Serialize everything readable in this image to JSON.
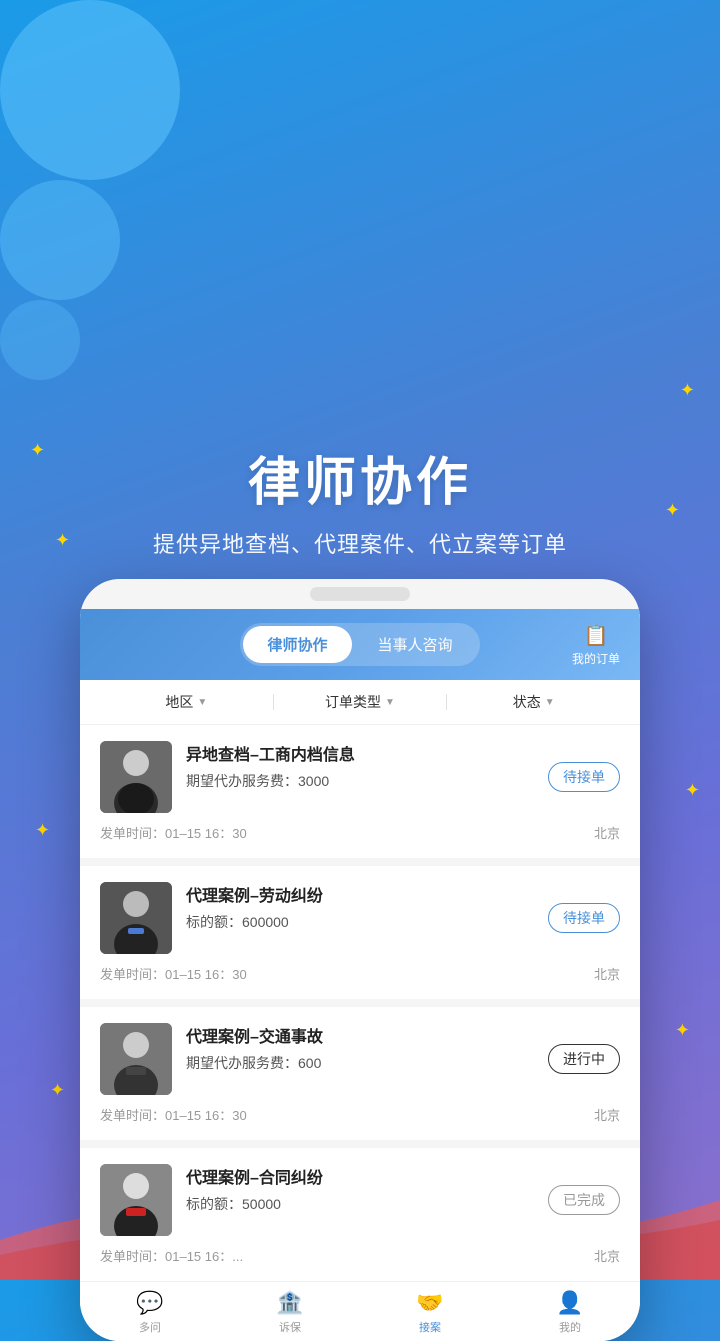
{
  "header": {
    "title": "律师协作",
    "subtitle": "提供异地查档、代理案件、代立案等订单"
  },
  "tabs": {
    "active": "律师协作",
    "inactive": "当事人咨询",
    "my_orders": "我的订单"
  },
  "filters": {
    "region": "地区",
    "order_type": "订单类型",
    "status": "状态"
  },
  "orders": [
    {
      "title": "异地查档–工商内档信息",
      "amount_label": "期望代办服务费：",
      "amount": "3000",
      "status": "待接单",
      "status_type": "pending",
      "time": "发单时间：01–15 16：30",
      "location": "北京"
    },
    {
      "title": "代理案例–劳动纠纷",
      "amount_label": "标的额：",
      "amount": "600000",
      "status": "待接单",
      "status_type": "pending",
      "time": "发单时间：01–15 16：30",
      "location": "北京"
    },
    {
      "title": "代理案例–交通事故",
      "amount_label": "期望代办服务费：",
      "amount": "600",
      "status": "进行中",
      "status_type": "ongoing",
      "time": "发单时间：01–15 16：30",
      "location": "北京"
    },
    {
      "title": "代理案例–合同纠纷",
      "amount_label": "标的额：",
      "amount": "50000",
      "status": "已完成",
      "status_type": "done",
      "time": "发单时间：01–15 16：...",
      "location": "北京"
    }
  ],
  "bottom_nav": [
    {
      "label": "多问",
      "icon": "💬",
      "active": false
    },
    {
      "label": "诉保",
      "icon": "🏦",
      "active": false
    },
    {
      "label": "接案",
      "icon": "🤝",
      "active": true
    },
    {
      "label": "我的",
      "icon": "👤",
      "active": false
    }
  ]
}
